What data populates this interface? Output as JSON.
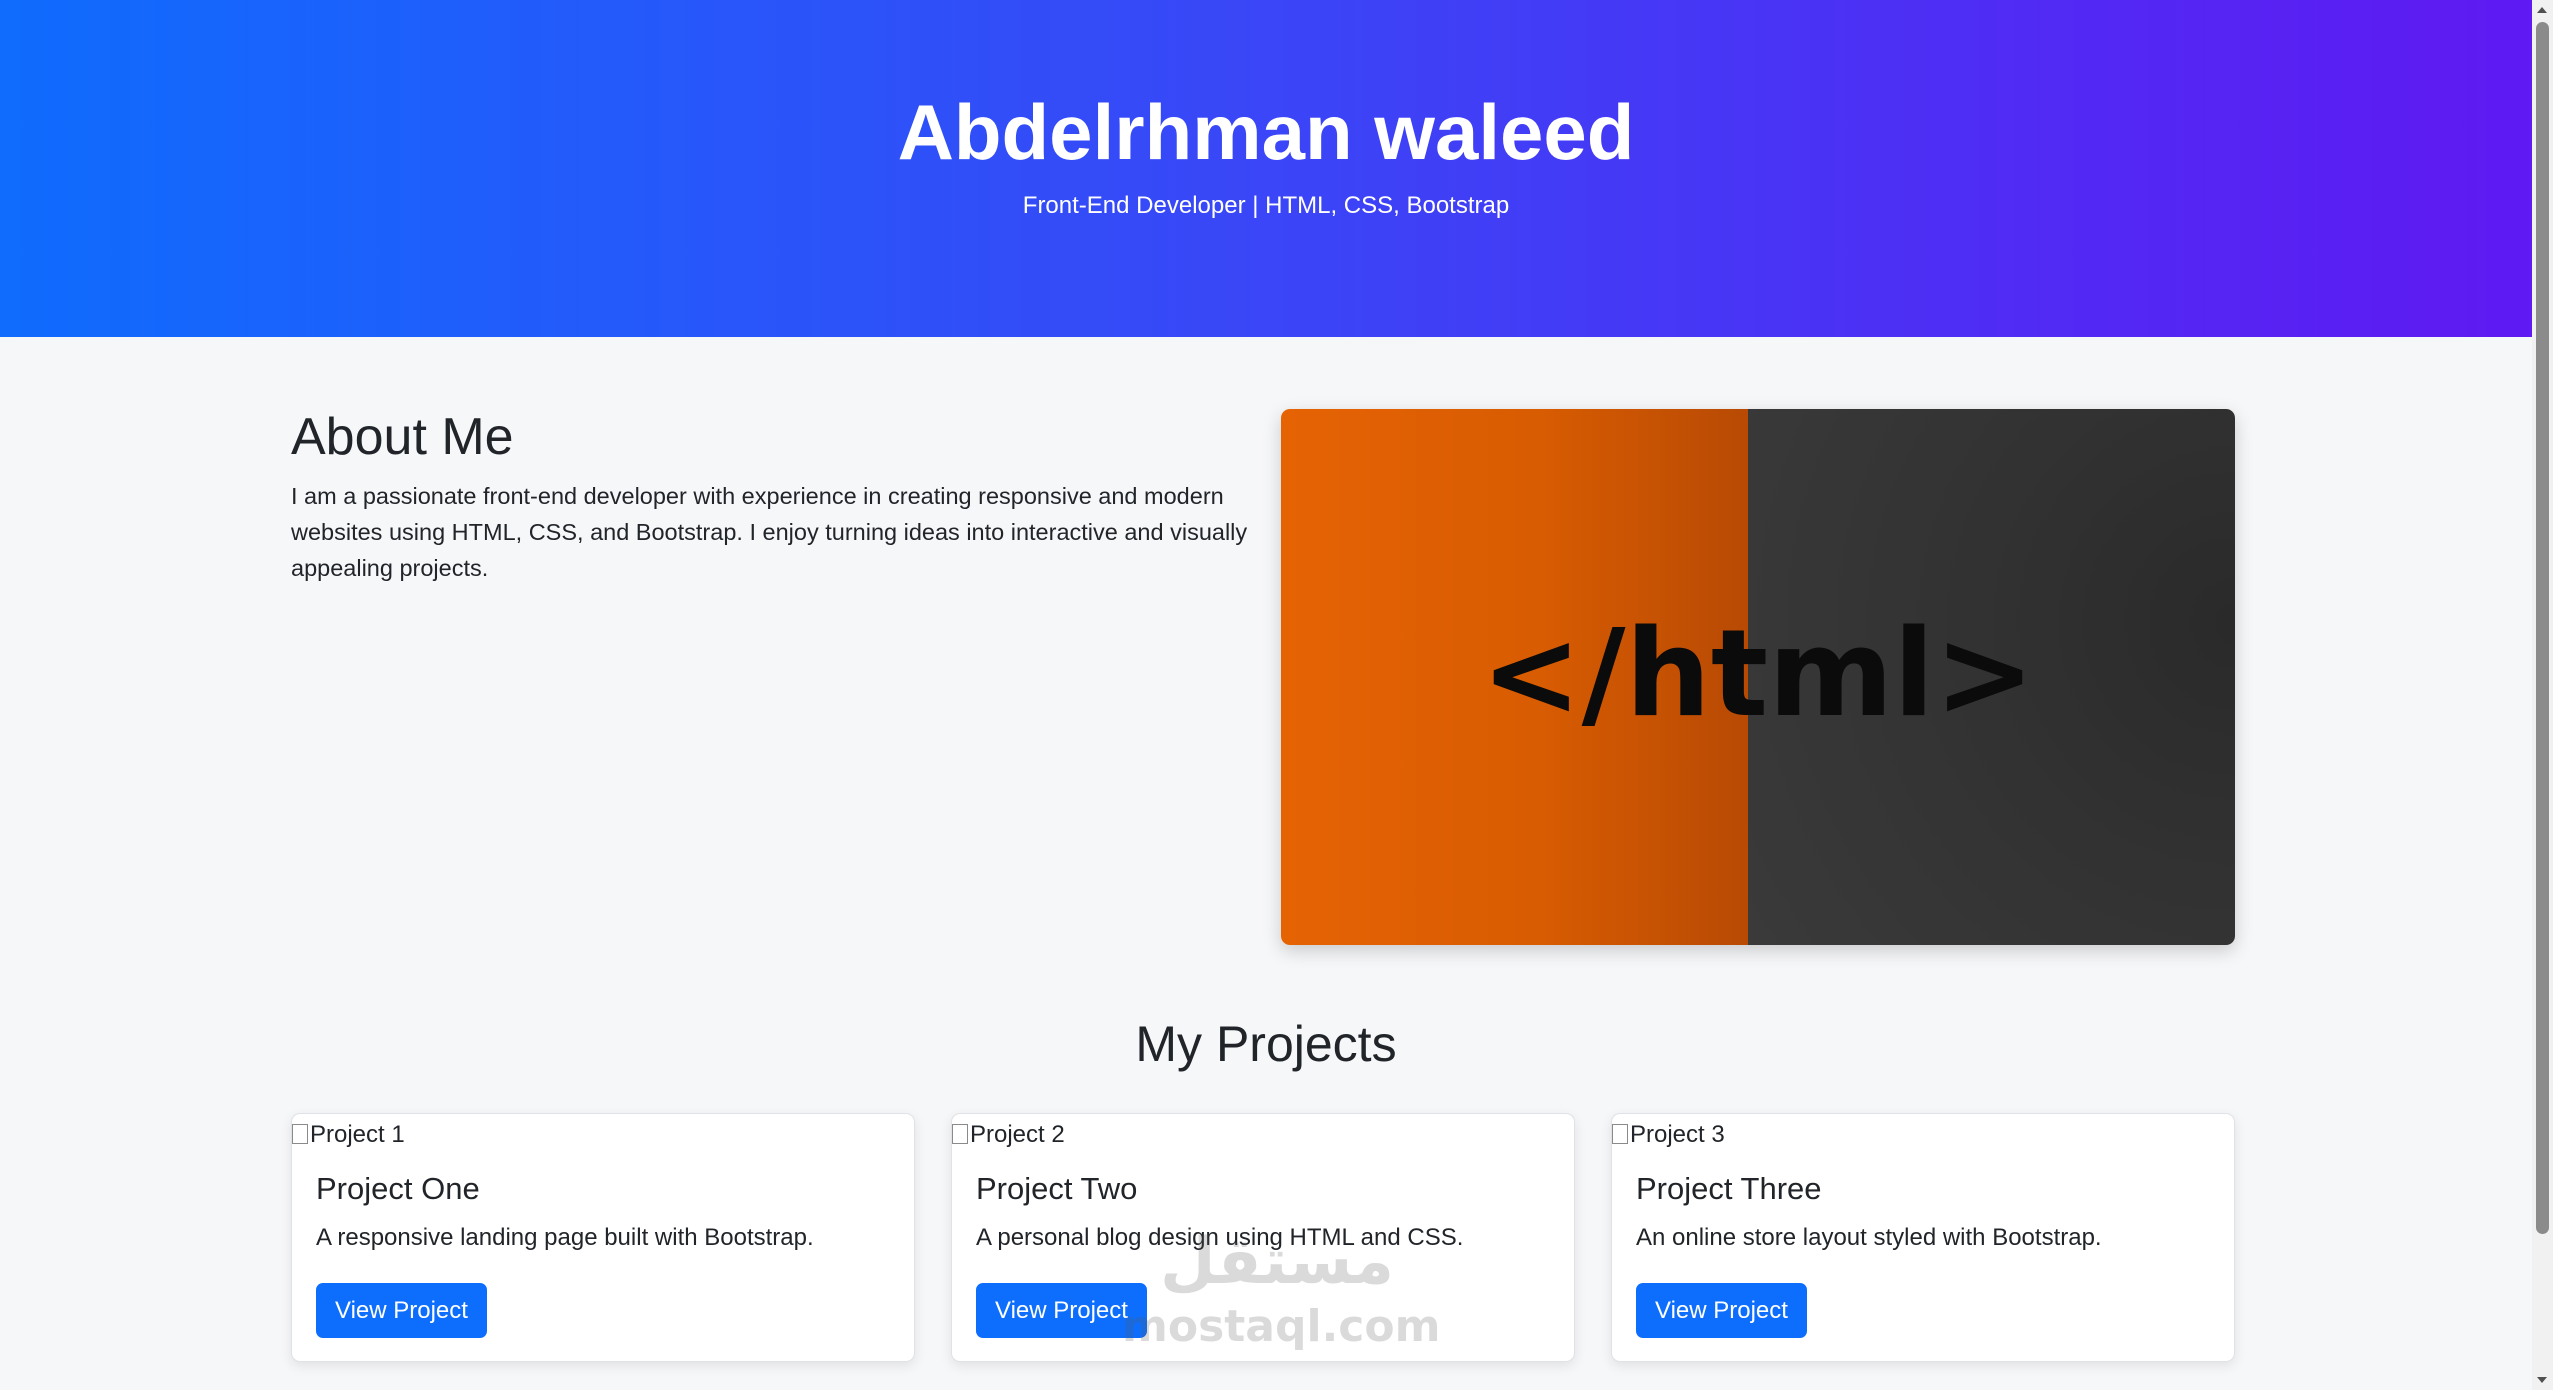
{
  "hero": {
    "name": "Abdelrhman waleed",
    "tagline": "Front-End Developer | HTML, CSS, Bootstrap",
    "gradient_start": "#0f6cfd",
    "gradient_end": "#5f19f2"
  },
  "about": {
    "title": "About Me",
    "text": "I am a passionate front-end developer with experience in creating responsive and modern websites using HTML, CSS, and Bootstrap. I enjoy turning ideas into interactive and visually appealing projects.",
    "image_text": "</html>"
  },
  "projects": {
    "title": "My Projects",
    "items": [
      {
        "img_alt": "Project 1",
        "title": "Project One",
        "text": "A responsive landing page built with Bootstrap.",
        "button": "View Project"
      },
      {
        "img_alt": "Project 2",
        "title": "Project Two",
        "text": "A personal blog design using HTML and CSS.",
        "button": "View Project"
      },
      {
        "img_alt": "Project 3",
        "title": "Project Three",
        "text": "An online store layout styled with Bootstrap.",
        "button": "View Project"
      }
    ]
  },
  "watermark": {
    "arabic": "مستقل",
    "latin": "mostaql.com"
  },
  "colors": {
    "button": "#0d6efd",
    "page_background": "#f6f7f9",
    "image_orange": "#e66304",
    "image_dark": "#333333"
  }
}
